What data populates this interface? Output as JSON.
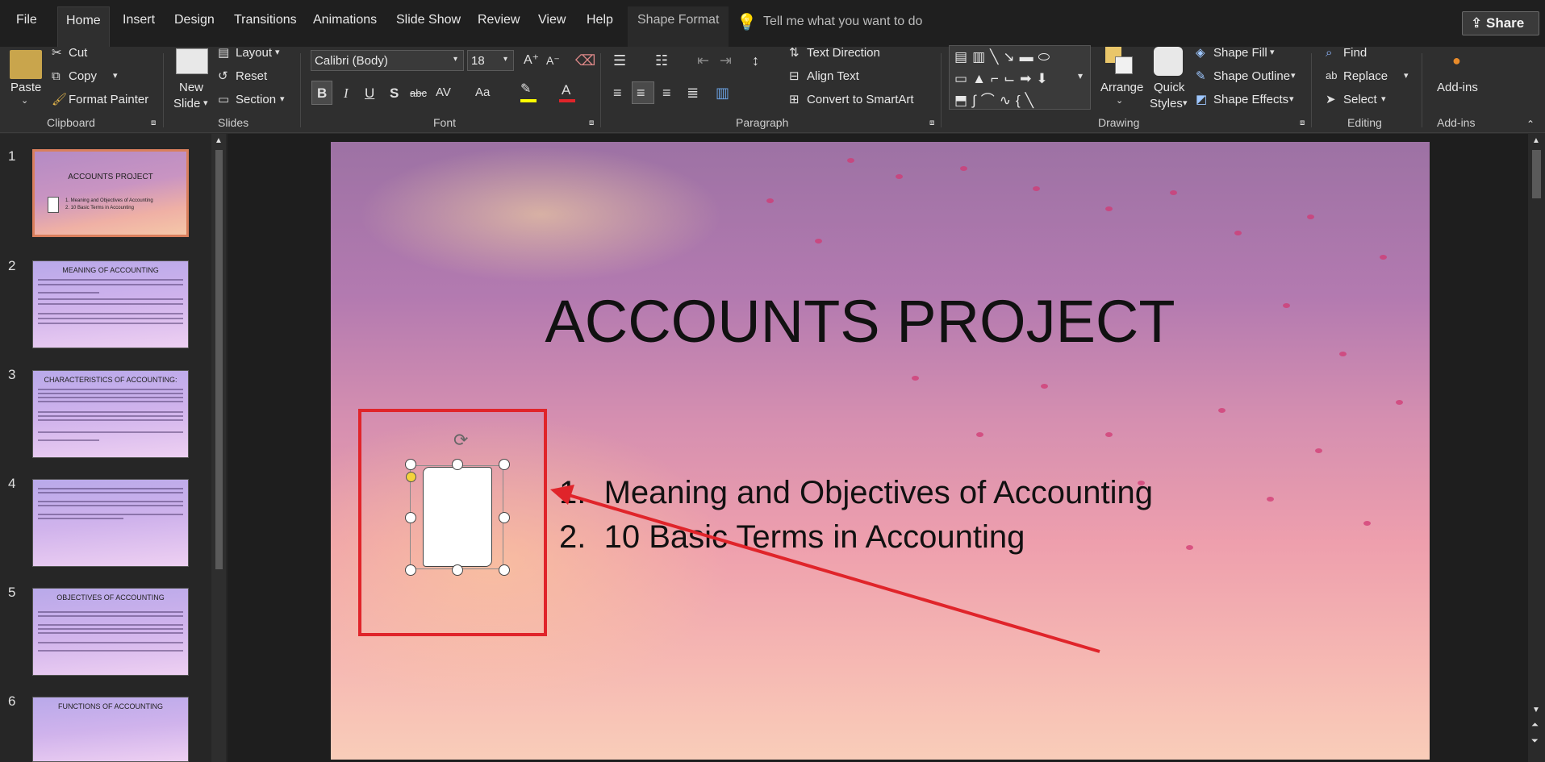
{
  "tabs": [
    "File",
    "Home",
    "Insert",
    "Design",
    "Transitions",
    "Animations",
    "Slide Show",
    "Review",
    "View",
    "Help",
    "Shape Format"
  ],
  "active_tab": "Home",
  "tell_me": "Tell me what you want to do",
  "share": "Share",
  "clipboard": {
    "paste": "Paste",
    "cut": "Cut",
    "copy": "Copy",
    "format_painter": "Format Painter",
    "group": "Clipboard"
  },
  "slides_group": {
    "new_slide_1": "New",
    "new_slide_2": "Slide",
    "layout": "Layout",
    "reset": "Reset",
    "section": "Section",
    "group": "Slides"
  },
  "font": {
    "name": "Calibri (Body)",
    "size": "18",
    "group": "Font",
    "bold": "B",
    "italic": "I",
    "underline": "U",
    "shadow": "S",
    "strike": "abc",
    "spacing": "AV",
    "case": "Aa"
  },
  "paragraph": {
    "text_direction": "Text Direction",
    "align_text": "Align Text",
    "convert_smartart": "Convert to SmartArt",
    "group": "Paragraph"
  },
  "drawing": {
    "arrange": "Arrange",
    "quick_1": "Quick",
    "quick_2": "Styles",
    "shape_fill": "Shape Fill",
    "shape_outline": "Shape Outline",
    "shape_effects": "Shape Effects",
    "group": "Drawing"
  },
  "editing": {
    "find": "Find",
    "replace": "Replace",
    "select": "Select",
    "group": "Editing"
  },
  "addins": {
    "label": "Add-ins",
    "group": "Add-ins"
  },
  "thumbnails": [
    {
      "num": "1",
      "title": "ACCOUNTS PROJECT",
      "lines": [
        "1. Meaning and Objectives of Accounting",
        "2. 10 Basic Terms in Accounting"
      ]
    },
    {
      "num": "2",
      "title": "MEANING OF ACCOUNTING"
    },
    {
      "num": "3",
      "title": "CHARACTERISTICS OF ACCOUNTING:"
    },
    {
      "num": "4",
      "title": ""
    },
    {
      "num": "5",
      "title": "OBJECTIVES OF ACCOUNTING"
    },
    {
      "num": "6",
      "title": "FUNCTIONS OF ACCOUNTING"
    }
  ],
  "slide": {
    "title": "ACCOUNTS PROJECT",
    "bullets": [
      {
        "num": "1.",
        "text": "Meaning and Objectives of Accounting"
      },
      {
        "num": "2.",
        "text": "10 Basic Terms in Accounting"
      }
    ]
  },
  "colors": {
    "accent_red": "#e0242a",
    "selection_border": "#d97f5d"
  }
}
